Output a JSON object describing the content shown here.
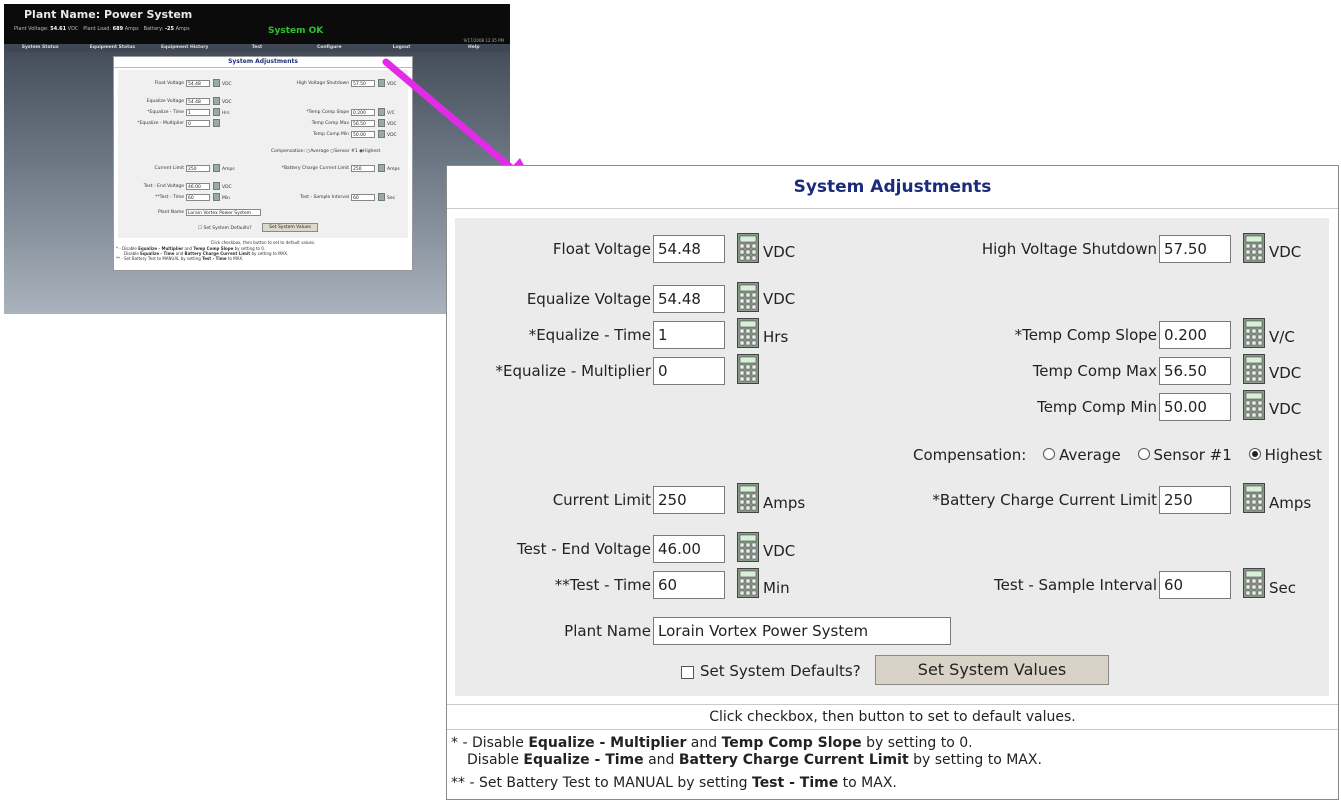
{
  "thumbnail": {
    "plant_name": "Plant Name: Power System",
    "stats": {
      "plant_voltage_label": "Plant Voltage:",
      "plant_voltage_value": "54.61",
      "plant_voltage_unit": "VDC",
      "plant_load_label": "Plant Load:",
      "plant_load_value": "689",
      "plant_load_unit": "Amps",
      "battery_label": "Battery:",
      "battery_value": "-25",
      "battery_unit": "Amps"
    },
    "status": "System OK",
    "timestamp": "9/17/2008 12:35 PM",
    "nav": [
      "System Status",
      "Equipment Status",
      "Equipment History",
      "Test",
      "Configure",
      "Logout",
      "Help"
    ]
  },
  "panel": {
    "title": "System Adjustments",
    "float_voltage": {
      "label": "Float Voltage",
      "value": "54.48",
      "unit": "VDC"
    },
    "high_voltage_shutdown": {
      "label": "High Voltage Shutdown",
      "value": "57.50",
      "unit": "VDC"
    },
    "equalize_voltage": {
      "label": "Equalize Voltage",
      "value": "54.48",
      "unit": "VDC"
    },
    "equalize_time": {
      "label": "*Equalize - Time",
      "value": "1",
      "unit": "Hrs"
    },
    "temp_comp_slope": {
      "label": "*Temp Comp Slope",
      "value": "0.200",
      "unit": "V/C"
    },
    "equalize_multiplier": {
      "label": "*Equalize - Multiplier",
      "value": "0"
    },
    "temp_comp_max": {
      "label": "Temp Comp Max",
      "value": "56.50",
      "unit": "VDC"
    },
    "temp_comp_min": {
      "label": "Temp Comp Min",
      "value": "50.00",
      "unit": "VDC"
    },
    "compensation": {
      "label": "Compensation:",
      "options": [
        "Average",
        "Sensor #1",
        "Highest"
      ],
      "selected": "Highest"
    },
    "current_limit": {
      "label": "Current Limit",
      "value": "250",
      "unit": "Amps"
    },
    "battery_charge_current_limit": {
      "label": "*Battery Charge Current Limit",
      "value": "250",
      "unit": "Amps"
    },
    "test_end_voltage": {
      "label": "Test - End Voltage",
      "value": "46.00",
      "unit": "VDC"
    },
    "test_time": {
      "label": "**Test - Time",
      "value": "60",
      "unit": "Min"
    },
    "test_sample_interval": {
      "label": "Test - Sample Interval",
      "value": "60",
      "unit": "Sec"
    },
    "plant_name": {
      "label": "Plant Name",
      "value": "Lorain Vortex Power System"
    },
    "set_defaults_label": "Set System Defaults?",
    "set_values_button": "Set System Values",
    "hint": "Click checkbox, then button to set to default values.",
    "notes": {
      "n1_prefix": "* - Disable ",
      "n1_b1": "Equalize - Multiplier",
      "n1_mid": " and ",
      "n1_b2": "Temp Comp Slope",
      "n1_suffix": " by setting to 0.",
      "n2_prefix": "Disable ",
      "n2_b1": "Equalize - Time",
      "n2_mid": " and ",
      "n2_b2": "Battery Charge Current Limit",
      "n2_suffix": " by setting to MAX.",
      "n3_prefix": "** - Set Battery Test to MANUAL by setting ",
      "n3_b1": "Test - Time",
      "n3_suffix": " to MAX."
    }
  },
  "colors": {
    "title_blue": "#1b2c7b",
    "arrow_magenta": "#e12be6",
    "status_green": "#2fc12f",
    "button_tan": "#d8d3c6"
  },
  "icons": {
    "keypad": "keypad-icon",
    "arrow": "pointer-arrow"
  }
}
